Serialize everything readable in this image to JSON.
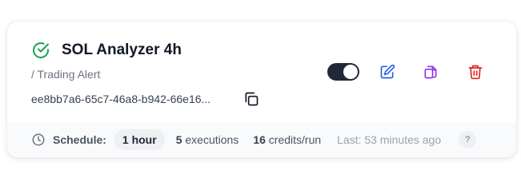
{
  "card": {
    "title": "SOL Analyzer 4h",
    "subtitle": "/ Trading Alert",
    "id_truncated": "ee8bb7a6-65c7-46a8-b942-66e16...",
    "status_icon": "check-circle-icon",
    "status_color": "#16a34a",
    "toggle_on": true
  },
  "actions": {
    "edit_icon": "pencil-square-icon",
    "edit_color": "#2563eb",
    "duplicate_icon": "duplicate-icon",
    "duplicate_color": "#9333ea",
    "delete_icon": "trash-icon",
    "delete_color": "#dc2626"
  },
  "footer": {
    "schedule_label": "Schedule:",
    "schedule_value": "1 hour",
    "executions_count": "5",
    "executions_label": "executions",
    "credits_count": "16",
    "credits_label": "credits/run",
    "last_run": "Last: 53 minutes ago",
    "help_label": "?"
  }
}
